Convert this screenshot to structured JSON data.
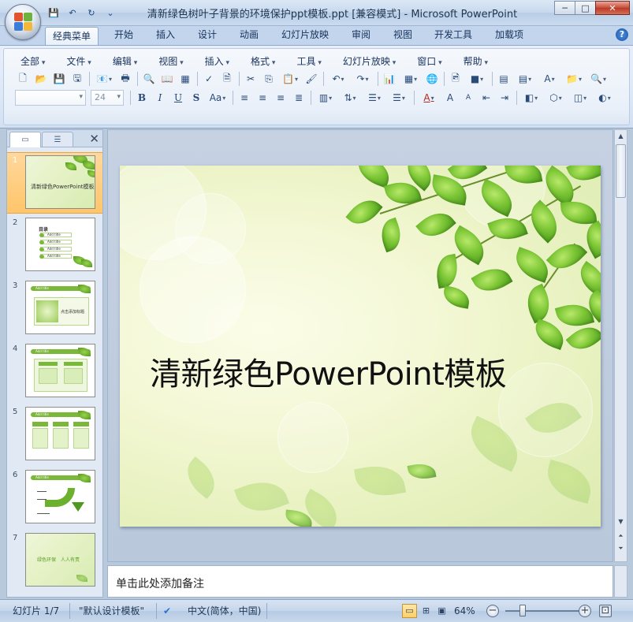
{
  "window": {
    "title": "清新绿色树叶子背景的环境保护ppt模板.ppt [兼容模式] - Microsoft PowerPoint",
    "controls": {
      "minimize": "─",
      "maximize": "□",
      "close": "✕"
    }
  },
  "quick_access": {
    "save_icon": "💾",
    "undo_icon": "↶",
    "redo_icon": "↻",
    "customize_icon": "⌄"
  },
  "ribbon_tabs": [
    "经典菜单",
    "开始",
    "插入",
    "设计",
    "动画",
    "幻灯片放映",
    "审阅",
    "视图",
    "开发工具",
    "加载项"
  ],
  "active_tab": "经典菜单",
  "help": "?",
  "classic_menu": [
    "全部",
    "文件",
    "编辑",
    "视图",
    "插入",
    "格式",
    "工具",
    "幻灯片放映",
    "窗口",
    "帮助"
  ],
  "toolbar1_glyphs": [
    "🗋",
    "📂",
    "💾",
    "🖫",
    "📧",
    "🖶",
    "🔍",
    "📖",
    "▦",
    "✓",
    "🗎",
    "✂",
    "⎘",
    "📋",
    "🖌",
    "↶",
    "↷",
    "📊",
    "▦",
    "🌐",
    "🖻",
    "■",
    "▤",
    "▤",
    "A",
    "📁",
    "🔍"
  ],
  "font_combo": {
    "name": "",
    "size": "24"
  },
  "format_glyphs": {
    "bold": "B",
    "italic": "I",
    "underline": "U",
    "shadow": "S",
    "case": "Aa"
  },
  "panel": {
    "tab_slides": "▭",
    "tab_outline": "☰",
    "close": "✕"
  },
  "slides": [
    {
      "num": "1",
      "title": "清新绿色PowerPoint模板",
      "selected": true
    },
    {
      "num": "2",
      "title": "目录",
      "items": [
        "Add title",
        "Add title",
        "Add title",
        "Add title"
      ]
    },
    {
      "num": "3",
      "header": "Add title",
      "label": "点击添加标题"
    },
    {
      "num": "4",
      "header": "Add title"
    },
    {
      "num": "5",
      "header": "Add title"
    },
    {
      "num": "6",
      "header": "Add title"
    },
    {
      "num": "7",
      "label": "绿色环保　人人有责"
    }
  ],
  "main_slide": {
    "title": "清新绿色PowerPoint模板"
  },
  "notes": {
    "placeholder": "单击此处添加备注"
  },
  "status": {
    "slide_info": "幻灯片 1/7",
    "theme": "\"默认设计模板\"",
    "language": "中文(简体，中国)",
    "zoom": "64%",
    "zoom_minus": "−",
    "zoom_plus": "+",
    "fit": "⊡"
  },
  "colors": {
    "accent_green": "#7ab83a",
    "selection": "#ffc56a",
    "ribbon_blue": "#c3d5ec"
  }
}
